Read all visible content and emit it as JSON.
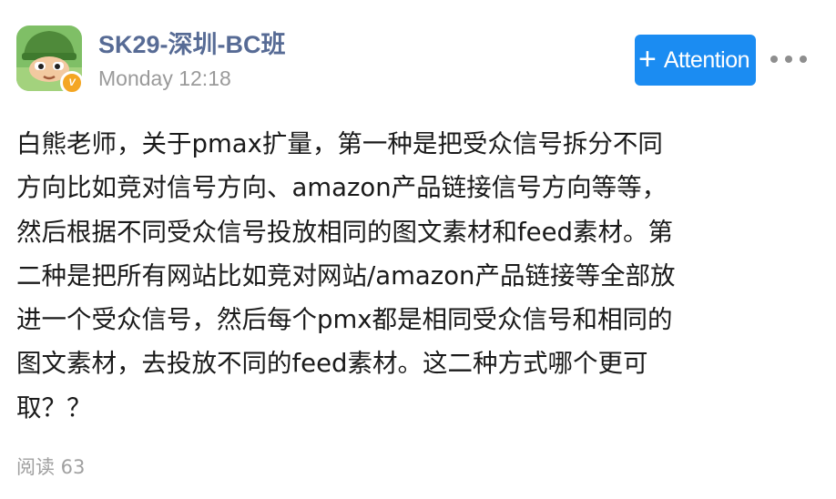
{
  "post": {
    "author": "SK29-深圳-BC班",
    "timestamp": "Monday 12:18",
    "avatar_badge": "V",
    "attention_button": {
      "icon": "plus-icon",
      "label": "Attention"
    },
    "more_icon": "more-dots-icon",
    "body_lines": [
      "白熊老师，关于pmax扩量，第一种是把受众信号拆分不同",
      "方向比如竞对信号方向、amazon产品链接信号方向等等，",
      "然后根据不同受众信号投放相同的图文素材和feed素材。第",
      "二种是把所有网站比如竞对网站/amazon产品链接等全部放",
      "进一个受众信号，然后每个pmx都是相同受众信号和相同的",
      "图文素材，去投放不同的feed素材。这二种方式哪个更可",
      "取？？"
    ],
    "read_count": "阅读 63"
  },
  "colors": {
    "author_link": "#576b95",
    "attention_button_bg": "#1b8cf2",
    "timestamp": "#9a9a9a",
    "body_text": "#1a1a1a",
    "badge": "#f4a623"
  }
}
